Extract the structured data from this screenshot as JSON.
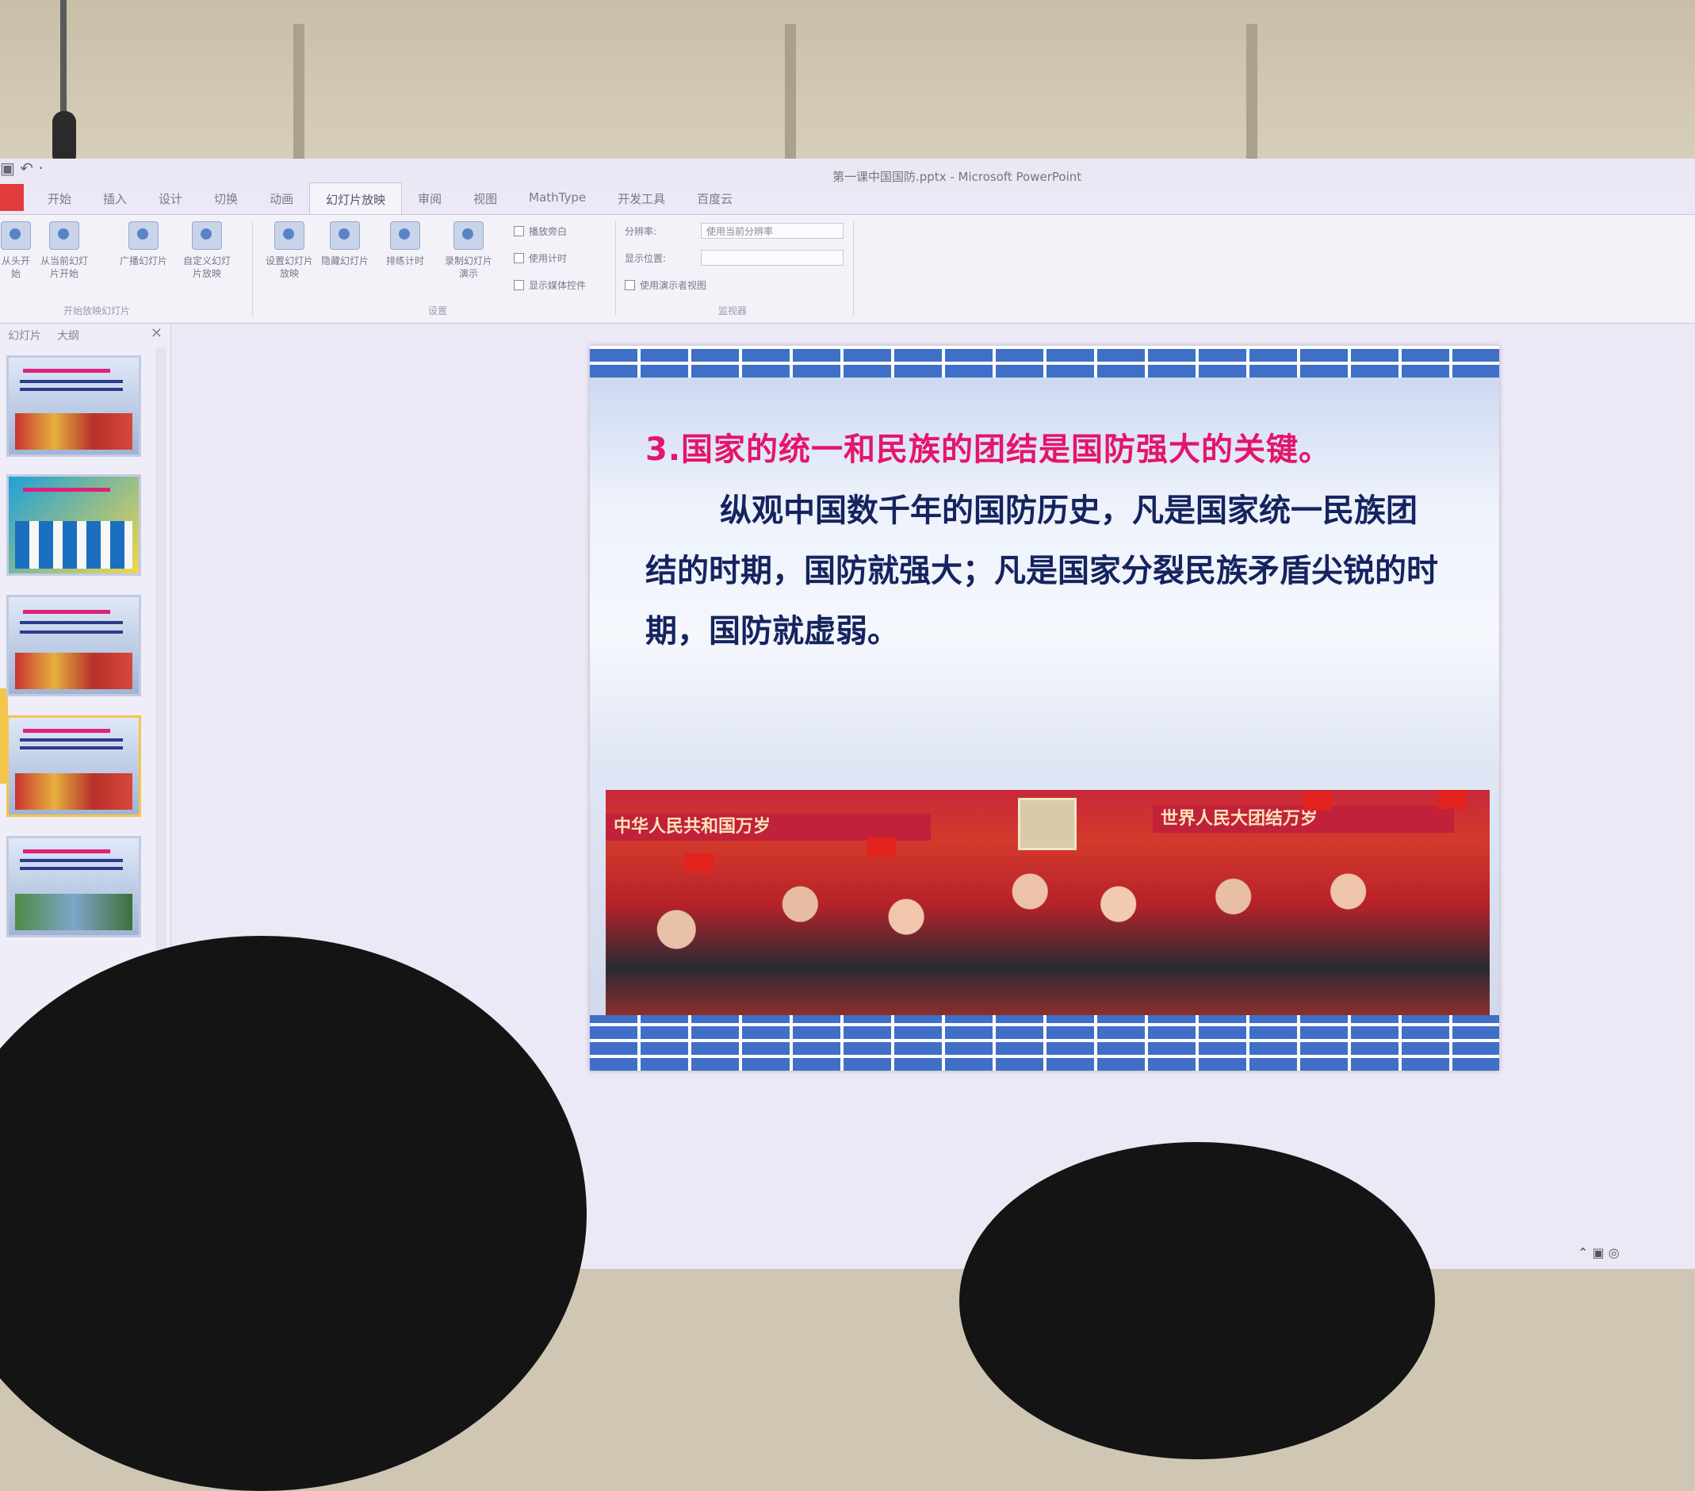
{
  "window": {
    "title": "第一课中国国防.pptx - Microsoft PowerPoint",
    "quick_access": "▣ ↶ ·"
  },
  "tabs": [
    "开始",
    "插入",
    "设计",
    "切换",
    "动画",
    "幻灯片放映",
    "审阅",
    "视图",
    "MathType",
    "开发工具",
    "百度云"
  ],
  "ribbon": {
    "start_group": {
      "buttons": [
        "从头开始",
        "从当前幻灯片开始",
        "广播幻灯片",
        "自定义幻灯片放映"
      ],
      "label": "开始放映幻灯片"
    },
    "setup_group": {
      "buttons": [
        "设置幻灯片放映",
        "隐藏幻灯片",
        "排练计时",
        "录制幻灯片演示"
      ],
      "checkboxes": [
        "播放旁白",
        "使用计时",
        "显示媒体控件"
      ],
      "label": "设置"
    },
    "monitor_group": {
      "resolution_label": "分辨率:",
      "resolution_value": "使用当前分辨率",
      "show_on_label": "显示位置:",
      "presenter_view": "使用演示者视图",
      "label": "监视器"
    }
  },
  "panel": {
    "tabs": [
      "幻灯片",
      "大纲"
    ],
    "close": "✕"
  },
  "slide": {
    "title": "3.国家的统一和民族的团结是国防强大的关键。",
    "body": "纵观中国数千年的国防历史，凡是国家统一民族团结的时期，国防就强大；凡是国家分裂民族矛盾尖锐的时期，国防就虚弱。",
    "photo_banner_left": "中华人民共和国万岁",
    "photo_banner_right": "世界人民大团结万岁"
  },
  "colors": {
    "title_red": "#e4156a",
    "body_navy": "#15245f",
    "wall_blue": "#3f6fc7",
    "file_tab": "#e23b3b"
  }
}
